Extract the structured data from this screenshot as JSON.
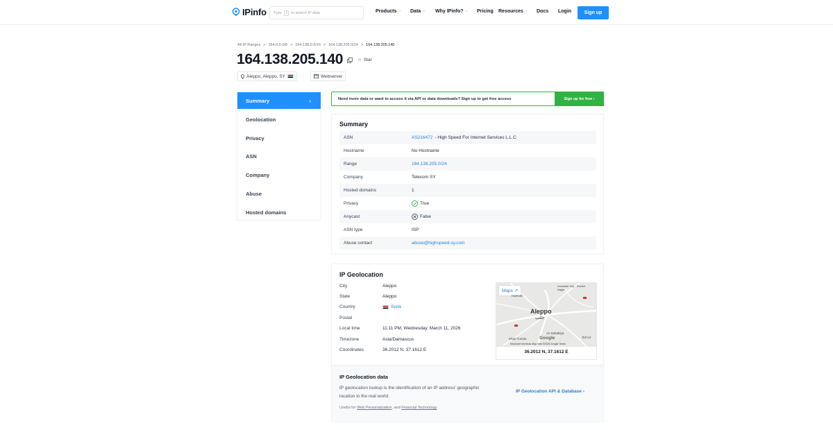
{
  "header": {
    "logo_text": "IPinfo",
    "search_placeholder_pre": "Type",
    "search_key": "/",
    "search_placeholder_post": "to search IP data",
    "nav": {
      "products": "Products",
      "data": "Data",
      "why": "Why IPinfo?",
      "pricing": "Pricing",
      "resources": "Resources",
      "docs": "Docs",
      "login": "Login"
    },
    "signup": "Sign up"
  },
  "breadcrumb": {
    "items": [
      "All IP Ranges",
      "164.0.0.0/8",
      "164.138.0.0/16",
      "164.138.205.0/24",
      "164.138.205.140"
    ]
  },
  "title": "164.138.205.140",
  "star_label": "Star",
  "tags": {
    "location": "Aleppo, Aleppo, SY",
    "type": "Webserver"
  },
  "sidebar": {
    "items": [
      "Summary",
      "Geolocation",
      "Privacy",
      "ASN",
      "Company",
      "Abuse",
      "Hosted domains"
    ]
  },
  "banner": {
    "text": "Need more data or want to access it via API or data downloads? Sign up to get free access",
    "button": "Sign up for free ›"
  },
  "summary": {
    "title": "Summary",
    "rows": {
      "asn": {
        "key": "ASN",
        "link": "AS216472",
        "rest": " - High Speed For Internet Services L.L.C"
      },
      "hostname": {
        "key": "Hostname",
        "value": "No Hostname"
      },
      "range": {
        "key": "Range",
        "value": "164.138.205.0/24"
      },
      "company": {
        "key": "Company",
        "value": "Telecom SY"
      },
      "hosted": {
        "key": "Hosted domains",
        "value": "1"
      },
      "privacy": {
        "key": "Privacy",
        "value": "True"
      },
      "anycast": {
        "key": "Anycast",
        "value": "False"
      },
      "asn_type": {
        "key": "ASN type",
        "value": "ISP"
      },
      "abuse": {
        "key": "Abuse contact",
        "value": "abuse@highspeed-sy.com"
      }
    }
  },
  "geolocation": {
    "title": "IP Geolocation",
    "rows": {
      "city": {
        "key": "City",
        "value": "Aleppo"
      },
      "state": {
        "key": "State",
        "value": "Aleppo"
      },
      "country": {
        "key": "Country",
        "value": "Syria"
      },
      "postal": {
        "key": "Postal",
        "value": ""
      },
      "local_time": {
        "key": "Local time",
        "value": "11:11 PM, Wednesday, March 11, 2026"
      },
      "timezone": {
        "key": "Timezone",
        "value": "Asia/Damascus"
      },
      "coordinates": {
        "key": "Coordinates",
        "value": "36.2012 N, 37.1612 E"
      }
    },
    "map": {
      "maps_button": "Maps",
      "city_label": "Aleppo",
      "city_label_ar": "حلب",
      "labels": [
        "Industrial City - Sheikh Najjar",
        "Az-Zahabiya",
        "Khan Tuman",
        "Tell Arr",
        "Hamrah"
      ],
      "google": "Google",
      "footer": "Keyboard shortcuts   Map data ©2026 Google   Terms",
      "coords": "36.2012 N, 37.1612 E"
    },
    "data_section": {
      "title": "IP Geolocation data",
      "desc": "IP geolocation lookup is the identification of an IP address' geographic location in the real world.",
      "useful_pre": "Useful for ",
      "useful_link1": "Web Personalization",
      "useful_mid": ", and ",
      "useful_link2": "Financial Technology",
      "api_link": "IP Geolocation API & Database ›"
    }
  },
  "colors": {
    "accent": "#1e90ff",
    "green": "#2fb344",
    "link": "#1e7fdc"
  }
}
